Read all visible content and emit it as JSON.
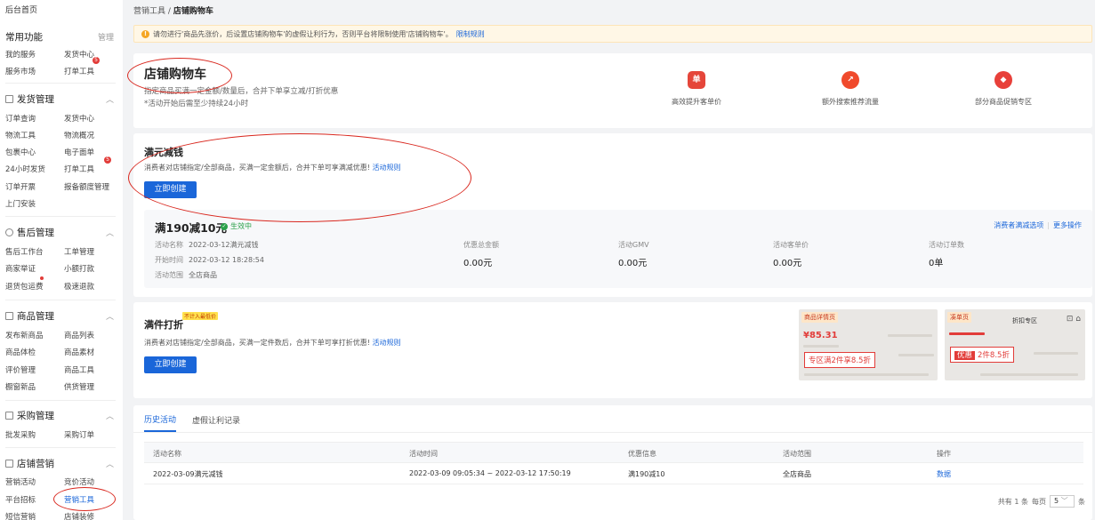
{
  "sidebar": {
    "home": "后台首页",
    "common": {
      "title": "常用功能",
      "manage": "管理",
      "items": [
        "我的服务",
        "发货中心",
        "服务市场",
        "打单工具"
      ],
      "badge": "5"
    },
    "shipping": {
      "title": "发货管理",
      "items": [
        "订单查询",
        "发货中心",
        "物流工具",
        "物流概况",
        "包裹中心",
        "电子面单",
        "24小时发货",
        "打单工具",
        "订单开票",
        "报备额度管理",
        "上门安装"
      ],
      "badge": "5"
    },
    "aftersale": {
      "title": "售后管理",
      "items": [
        "售后工作台",
        "工单管理",
        "商家举证",
        "小额打款",
        "退货包运费",
        "极速退款"
      ]
    },
    "goods": {
      "title": "商品管理",
      "items": [
        "发布新商品",
        "商品列表",
        "商品体检",
        "商品素材",
        "评价管理",
        "商品工具",
        "橱窗新品",
        "供货管理"
      ]
    },
    "purchase": {
      "title": "采购管理",
      "items": [
        "批发采购",
        "采购订单"
      ]
    },
    "marketing": {
      "title": "店铺营销",
      "items": [
        "营销活动",
        "竞价活动",
        "平台招标",
        "营销工具",
        "短信营销",
        "店铺装修"
      ]
    }
  },
  "breadcrumb": {
    "parent": "营销工具",
    "sep": "/",
    "current": "店铺购物车"
  },
  "notice": {
    "text": "请勿进行'商品先涨价，后设置店铺购物车'的虚假让利行为，否则平台将限制使用'店铺购物车'。",
    "link": "限制规则"
  },
  "hero": {
    "title": "店铺购物车",
    "line1": "指定商品买满一定金额/数量后，合并下单享立减/打折优惠",
    "line2": "*活动开始后需至少持续24小时",
    "features": [
      {
        "icon": "单",
        "label": "高效提升客单价"
      },
      {
        "icon": "↗",
        "label": "额外搜索推荐流量"
      },
      {
        "icon": "◆",
        "label": "部分商品促销专区"
      }
    ]
  },
  "manjian": {
    "title": "满元减钱",
    "desc": "消费者对店铺指定/全部商品，买满一定金额后，合并下单可享满减优惠!",
    "rule_link": "活动规则",
    "create": "立即创建",
    "promo": {
      "name": "满190减10元",
      "status": "生效中",
      "link1": "消费者满减选项",
      "link2": "更多操作",
      "fields": [
        {
          "k": "活动名称",
          "v": "2022-03-12满元减钱"
        },
        {
          "k": "开始时间",
          "v": "2022-03-12 18:28:54"
        },
        {
          "k": "活动范围",
          "v": "全店商品"
        }
      ],
      "metrics": [
        {
          "label": "优惠总金额",
          "value": "0.00元"
        },
        {
          "label": "活动GMV",
          "value": "0.00元"
        },
        {
          "label": "活动客单价",
          "value": "0.00元"
        },
        {
          "label": "活动订单数",
          "value": "0单"
        }
      ]
    }
  },
  "manjianzhe": {
    "title": "满件打折",
    "tag": "不计入最低价",
    "desc": "消费者对店铺指定/全部商品，买满一定件数后，合并下单可享打折优惠!",
    "rule_link": "活动规则",
    "create": "立即创建",
    "preview1": {
      "header": "商品详情页",
      "price": "¥85.31",
      "chip": "专区满2件享8.5折"
    },
    "preview2": {
      "header": "凑单页",
      "title": "折扣专区",
      "chip_tag": "优惠",
      "chip": "2件8.5折"
    }
  },
  "history": {
    "tabs": [
      "历史活动",
      "虚假让利记录"
    ],
    "columns": [
      "活动名称",
      "活动时间",
      "优惠信息",
      "活动范围",
      "操作"
    ],
    "rows": [
      {
        "name": "2022-03-09满元减钱",
        "time": "2022-03-09 09:05:34 ~ 2022-03-12 17:50:19",
        "info": "满190减10",
        "scope": "全店商品",
        "op": "数据"
      }
    ],
    "pager": {
      "total": "共有 1 条",
      "per": "每页",
      "size": "5",
      "unit": "条"
    }
  }
}
